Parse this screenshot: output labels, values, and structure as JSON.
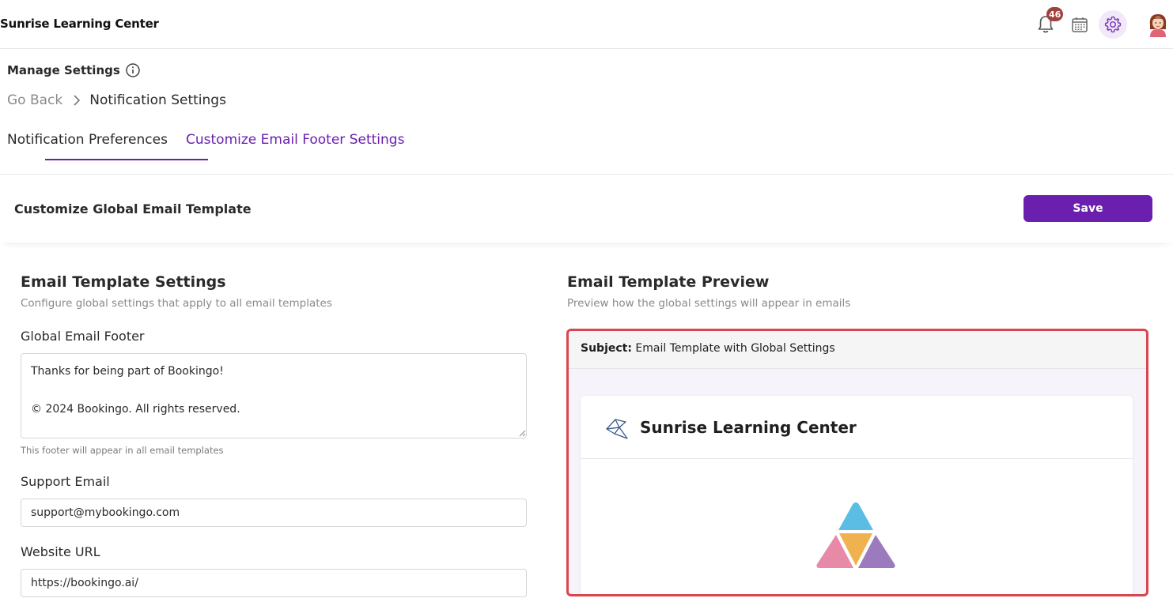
{
  "app": {
    "title": "Sunrise Learning Center"
  },
  "topbar": {
    "notification_count": "46"
  },
  "header": {
    "title": "Manage Settings",
    "breadcrumb": {
      "back": "Go Back",
      "current": "Notification Settings"
    }
  },
  "tabs": [
    {
      "label": "Notification Preferences",
      "active": false
    },
    {
      "label": "Customize Email Footer Settings",
      "active": true
    }
  ],
  "section": {
    "title": "Customize Global Email Template",
    "save_label": "Save"
  },
  "settings": {
    "title": "Email Template Settings",
    "subtitle": "Configure global settings that apply to all email templates",
    "footer_label": "Global Email Footer",
    "footer_value": "Thanks for being part of Bookingo!\n\n© 2024 Bookingo. All rights reserved.",
    "footer_hint": "This footer will appear in all email templates",
    "support_label": "Support Email",
    "support_value": "support@mybookingo.com",
    "website_label": "Website URL",
    "website_value": "https://bookingo.ai/"
  },
  "preview": {
    "title": "Email Template Preview",
    "subtitle": "Preview how the global settings will appear in emails",
    "subject_label": "Subject:",
    "subject_value": "Email Template with Global Settings",
    "card_title": "Sunrise Learning Center"
  },
  "colors": {
    "accent": "#6a1fae",
    "highlight_border": "#d9464f",
    "logo_top": "#5bbde4",
    "logo_center": "#f0b24f",
    "logo_left": "#e78aa8",
    "logo_right": "#9b7bbd"
  }
}
